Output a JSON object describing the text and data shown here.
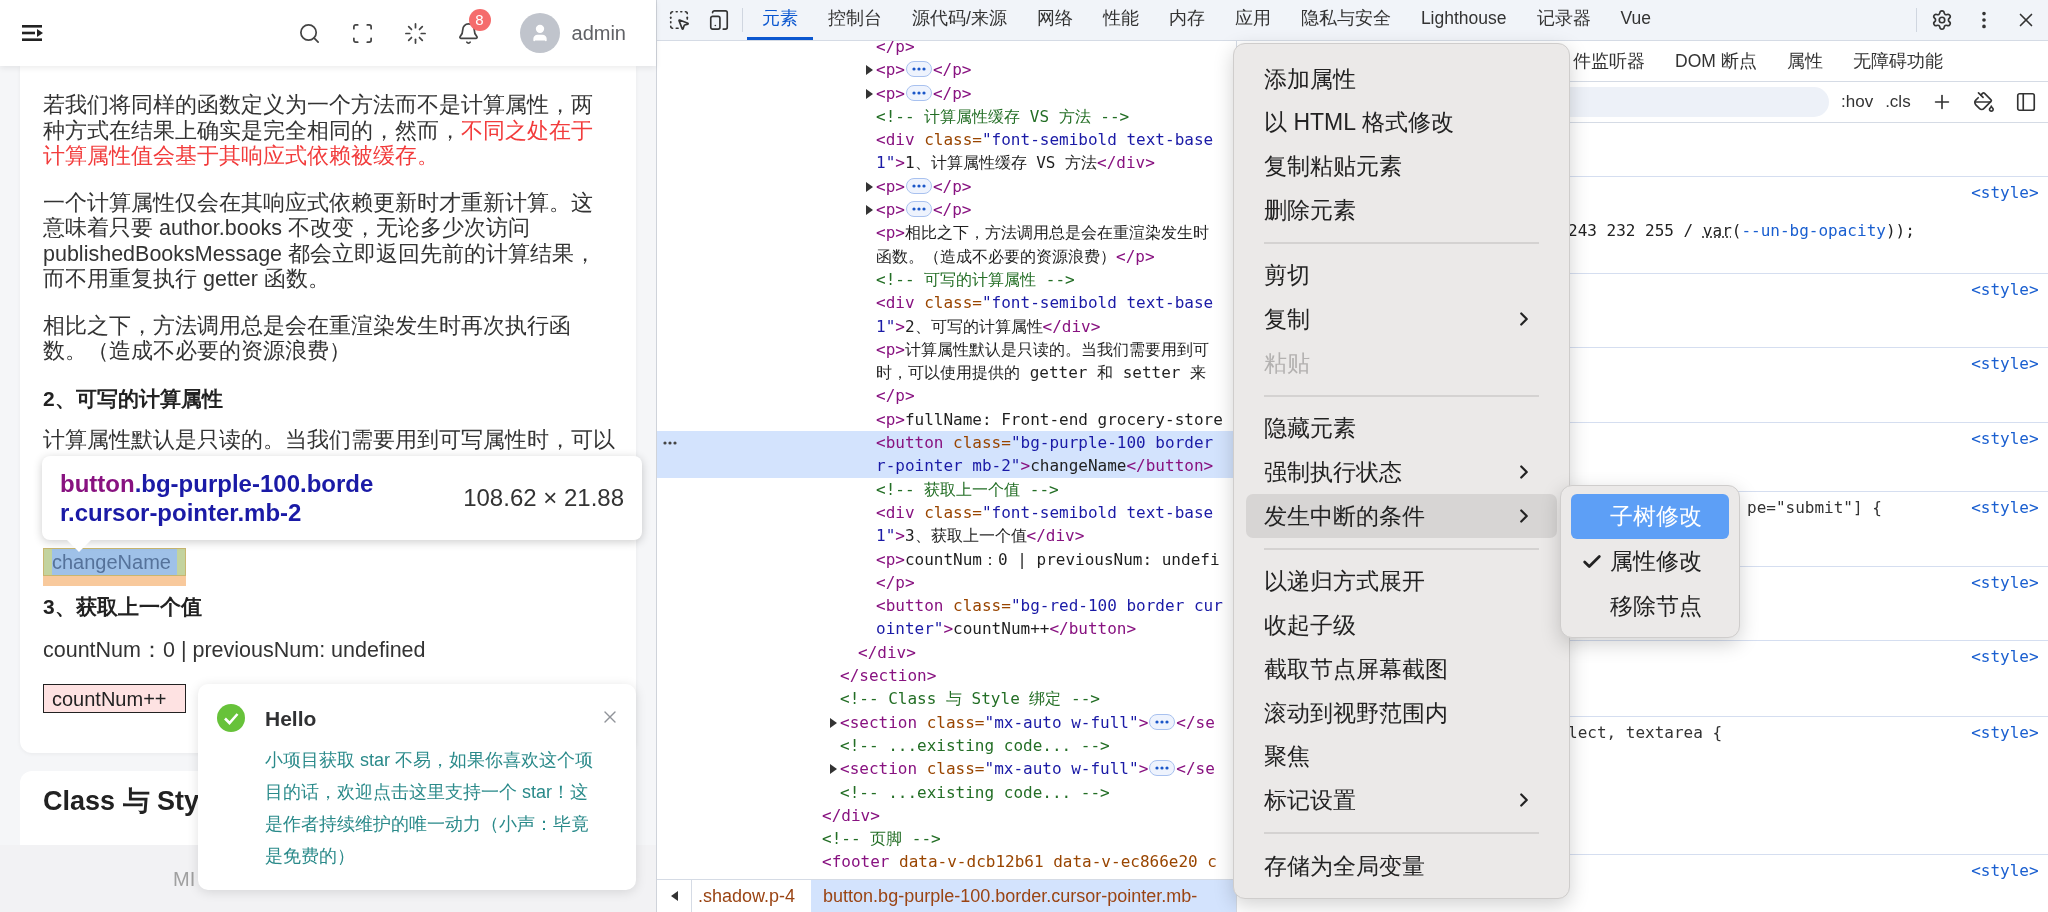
{
  "app_header": {
    "notifications": "8",
    "user": "admin"
  },
  "article": {
    "blocks": [
      {
        "kind": "paragraph",
        "segments": [
          {
            "text": "若我们将同样的函数定义为一个方法而不是计算属性，两种方式在结果上确实是完全相同的，然而，",
            "emphasis": false
          },
          {
            "text": "不同之处在于计算属性值会基于其响应式依赖被缓存。",
            "emphasis": true
          }
        ]
      },
      {
        "kind": "paragraph",
        "segments": [
          {
            "text": "一个计算属性仅会在其响应式依赖更新时才重新计算。这意味着只要 author.books 不改变，无论多少次访问 publishedBooksMessage 都会立即返回先前的计算结果，而不用重复执行 getter 函数。",
            "emphasis": false
          }
        ]
      },
      {
        "kind": "paragraph",
        "segments": [
          {
            "text": "相比之下，方法调用总是会在重渲染发生时再次执行函数。（造成不必要的资源浪费）",
            "emphasis": false
          }
        ]
      },
      {
        "kind": "heading",
        "text": "2、可写的计算属性"
      },
      {
        "kind": "covered_paragraph",
        "segments": [
          {
            "text": "计算属性默认是只读的。当我们需要用到可写属性时，可以",
            "emphasis": false
          }
        ]
      },
      {
        "kind": "button",
        "text": "changeName",
        "inspected": true
      },
      {
        "kind": "heading",
        "text": "3、获取上一个值"
      },
      {
        "kind": "paragraph",
        "segments": [
          {
            "text": "countNum：0 | previousNum: undefined",
            "emphasis": false
          }
        ]
      },
      {
        "kind": "button",
        "text": "countNum++",
        "inspected": false
      }
    ]
  },
  "next_card": {
    "title": "Class 与 Sty"
  },
  "footer": {
    "text": "MI"
  },
  "inspector_tooltip": {
    "tag": "button",
    "classes": ".bg-purple-100.border.cursor-pointer.mb-2",
    "size": "108.62 × 21.88"
  },
  "notification": {
    "title": "Hello",
    "message": "小项目获取 star 不易，如果你喜欢这个项目的话，欢迎点击这里支持一个 star！这是作者持续维护的唯一动力（小声：毕竟是免费的）"
  },
  "devtools": {
    "tabs": [
      {
        "label": "元素",
        "selected": true
      },
      {
        "label": "控制台",
        "selected": false
      },
      {
        "label": "源代码/来源",
        "selected": false
      },
      {
        "label": "网络",
        "selected": false
      },
      {
        "label": "性能",
        "selected": false
      },
      {
        "label": "内存",
        "selected": false
      },
      {
        "label": "应用",
        "selected": false
      },
      {
        "label": "隐私与安全",
        "selected": false
      },
      {
        "label": "Lighthouse",
        "selected": false
      },
      {
        "label": "记录器",
        "selected": false
      },
      {
        "label": "Vue",
        "selected": false
      }
    ]
  },
  "tree": [
    {
      "selected": false,
      "collapsed": false,
      "children": [
        {
          "selected": false,
          "collapsed": false,
          "children": [
            {
              "selected": false,
              "collapsed": false,
              "children": [
                {
                  "selected": false,
                  "collapsed": false,
                  "lines": [
                    [
                      {
                        "kind": "tag",
                        "text": "</p>"
                      }
                    ]
                  ]
                },
                {
                  "selected": false,
                  "collapsed": true,
                  "lines": [
                    [
                      {
                        "kind": "tag",
                        "text": "<p>"
                      },
                      {
                        "kind": "more"
                      },
                      {
                        "kind": "tag",
                        "text": "</p>"
                      }
                    ]
                  ]
                },
                {
                  "selected": false,
                  "collapsed": true,
                  "lines": [
                    [
                      {
                        "kind": "tag",
                        "text": "<p>"
                      },
                      {
                        "kind": "more"
                      },
                      {
                        "kind": "tag",
                        "text": "</p>"
                      }
                    ]
                  ]
                },
                {
                  "selected": false,
                  "collapsed": false,
                  "lines": [
                    [
                      {
                        "kind": "comment",
                        "text": "<!-- 计算属性缓存 VS 方法 -->"
                      }
                    ]
                  ]
                },
                {
                  "selected": false,
                  "collapsed": false,
                  "lines": [
                    [
                      {
                        "kind": "tag",
                        "text": "<div"
                      },
                      {
                        "kind": "attr",
                        "text": " class="
                      },
                      {
                        "kind": "value",
                        "text": "\"font-semibold text-base"
                      }
                    ],
                    [
                      {
                        "kind": "value",
                        "text": "1\""
                      },
                      {
                        "kind": "tag",
                        "text": ">"
                      },
                      {
                        "kind": "text",
                        "text": "1、计算属性缓存 VS 方法"
                      },
                      {
                        "kind": "tag",
                        "text": "</div>"
                      }
                    ]
                  ]
                },
                {
                  "selected": false,
                  "collapsed": true,
                  "lines": [
                    [
                      {
                        "kind": "tag",
                        "text": "<p>"
                      },
                      {
                        "kind": "more"
                      },
                      {
                        "kind": "tag",
                        "text": "</p>"
                      }
                    ]
                  ]
                },
                {
                  "selected": false,
                  "collapsed": true,
                  "lines": [
                    [
                      {
                        "kind": "tag",
                        "text": "<p>"
                      },
                      {
                        "kind": "more"
                      },
                      {
                        "kind": "tag",
                        "text": "</p>"
                      }
                    ]
                  ]
                },
                {
                  "selected": false,
                  "collapsed": false,
                  "lines": [
                    [
                      {
                        "kind": "tag",
                        "text": "<p>"
                      },
                      {
                        "kind": "text",
                        "text": "相比之下，方法调用总是会在重渲染发生时"
                      }
                    ],
                    [
                      {
                        "kind": "text",
                        "text": "函数。（造成不必要的资源浪费）"
                      },
                      {
                        "kind": "tag",
                        "text": "</p>"
                      }
                    ]
                  ]
                },
                {
                  "selected": false,
                  "collapsed": false,
                  "lines": [
                    [
                      {
                        "kind": "comment",
                        "text": "<!-- 可写的计算属性 -->"
                      }
                    ]
                  ]
                },
                {
                  "selected": false,
                  "collapsed": false,
                  "lines": [
                    [
                      {
                        "kind": "tag",
                        "text": "<div"
                      },
                      {
                        "kind": "attr",
                        "text": " class="
                      },
                      {
                        "kind": "value",
                        "text": "\"font-semibold text-base"
                      }
                    ],
                    [
                      {
                        "kind": "value",
                        "text": "1\""
                      },
                      {
                        "kind": "tag",
                        "text": ">"
                      },
                      {
                        "kind": "text",
                        "text": "2、可写的计算属性"
                      },
                      {
                        "kind": "tag",
                        "text": "</div>"
                      }
                    ]
                  ]
                },
                {
                  "selected": false,
                  "collapsed": false,
                  "lines": [
                    [
                      {
                        "kind": "tag",
                        "text": "<p>"
                      },
                      {
                        "kind": "text",
                        "text": "计算属性默认是只读的。当我们需要用到可"
                      }
                    ],
                    [
                      {
                        "kind": "text",
                        "text": "时，可以使用提供的 getter 和 setter 来"
                      }
                    ],
                    [
                      {
                        "kind": "tag",
                        "text": "</p>"
                      }
                    ]
                  ]
                },
                {
                  "selected": false,
                  "collapsed": false,
                  "lines": [
                    [
                      {
                        "kind": "tag",
                        "text": "<p>"
                      },
                      {
                        "kind": "text",
                        "text": "fullName: Front-end grocery-store"
                      }
                    ]
                  ]
                },
                {
                  "selected": true,
                  "collapsed": false,
                  "lines": [
                    [
                      {
                        "kind": "tag",
                        "text": "<button"
                      },
                      {
                        "kind": "attr",
                        "text": " class="
                      },
                      {
                        "kind": "value",
                        "text": "\"bg-purple-100 border"
                      }
                    ],
                    [
                      {
                        "kind": "value",
                        "text": "r-pointer mb-2\""
                      },
                      {
                        "kind": "tag",
                        "text": ">"
                      },
                      {
                        "kind": "text",
                        "text": "changeName"
                      },
                      {
                        "kind": "tag",
                        "text": "</button>"
                      }
                    ]
                  ]
                },
                {
                  "selected": false,
                  "collapsed": false,
                  "lines": [
                    [
                      {
                        "kind": "comment",
                        "text": "<!-- 获取上一个值 -->"
                      }
                    ]
                  ]
                },
                {
                  "selected": false,
                  "collapsed": false,
                  "lines": [
                    [
                      {
                        "kind": "tag",
                        "text": "<div"
                      },
                      {
                        "kind": "attr",
                        "text": " class="
                      },
                      {
                        "kind": "value",
                        "text": "\"font-semibold text-base"
                      }
                    ],
                    [
                      {
                        "kind": "value",
                        "text": "1\""
                      },
                      {
                        "kind": "tag",
                        "text": ">"
                      },
                      {
                        "kind": "text",
                        "text": "3、获取上一个值"
                      },
                      {
                        "kind": "tag",
                        "text": "</div>"
                      }
                    ]
                  ]
                },
                {
                  "selected": false,
                  "collapsed": false,
                  "lines": [
                    [
                      {
                        "kind": "tag",
                        "text": "<p>"
                      },
                      {
                        "kind": "text",
                        "text": "countNum：0 | previousNum: undefi"
                      }
                    ],
                    [
                      {
                        "kind": "tag",
                        "text": "</p>"
                      }
                    ]
                  ]
                },
                {
                  "selected": false,
                  "collapsed": false,
                  "lines": [
                    [
                      {
                        "kind": "tag",
                        "text": "<button"
                      },
                      {
                        "kind": "attr",
                        "text": " class="
                      },
                      {
                        "kind": "value",
                        "text": "\"bg-red-100 border cur"
                      }
                    ],
                    [
                      {
                        "kind": "value",
                        "text": "ointer\""
                      },
                      {
                        "kind": "tag",
                        "text": ">"
                      },
                      {
                        "kind": "text",
                        "text": "countNum++"
                      },
                      {
                        "kind": "tag",
                        "text": "</button>"
                      }
                    ]
                  ]
                }
              ],
              "close": [
                {
                  "kind": "tag",
                  "text": "</div>"
                }
              ]
            }
          ],
          "close": [
            {
              "kind": "tag",
              "text": "</section>"
            }
          ]
        },
        {
          "selected": false,
          "collapsed": false,
          "lines": [
            [
              {
                "kind": "comment",
                "text": "<!-- Class 与 Style 绑定 -->"
              }
            ]
          ]
        },
        {
          "selected": false,
          "collapsed": true,
          "lines": [
            [
              {
                "kind": "tag",
                "text": "<section"
              },
              {
                "kind": "attr",
                "text": " class="
              },
              {
                "kind": "value",
                "text": "\"mx-auto w-full\""
              },
              {
                "kind": "tag",
                "text": ">"
              },
              {
                "kind": "more"
              },
              {
                "kind": "tag",
                "text": "</se"
              }
            ]
          ]
        },
        {
          "selected": false,
          "collapsed": false,
          "lines": [
            [
              {
                "kind": "comment",
                "text": "<!-- ...existing code... -->"
              }
            ]
          ]
        },
        {
          "selected": false,
          "collapsed": true,
          "lines": [
            [
              {
                "kind": "tag",
                "text": "<section"
              },
              {
                "kind": "attr",
                "text": " class="
              },
              {
                "kind": "value",
                "text": "\"mx-auto w-full\""
              },
              {
                "kind": "tag",
                "text": ">"
              },
              {
                "kind": "more"
              },
              {
                "kind": "tag",
                "text": "</se"
              }
            ]
          ]
        },
        {
          "selected": false,
          "collapsed": false,
          "lines": [
            [
              {
                "kind": "comment",
                "text": "<!-- ...existing code... -->"
              }
            ]
          ]
        }
      ],
      "close": [
        {
          "kind": "tag",
          "text": "</div>"
        }
      ]
    },
    {
      "selected": false,
      "collapsed": false,
      "lines": [
        [
          {
            "kind": "comment",
            "text": "<!-- 页脚 -->"
          }
        ]
      ]
    },
    {
      "selected": false,
      "collapsed": false,
      "lines": [
        [
          {
            "kind": "tag",
            "text": "<footer"
          },
          {
            "kind": "attr",
            "text": " data-v-dcb12b61 data-v-ec866e20 c"
          }
        ]
      ]
    }
  ],
  "breadcrumbs": [
    {
      "label": ".shadow.p-4",
      "selected": false
    },
    {
      "label": "button.bg-purple-100.border.cursor-pointer.mb-",
      "selected": true
    }
  ],
  "styles_pane": {
    "tabs": [
      "件监听器",
      "DOM 断点",
      "属性",
      "无障碍功能"
    ],
    "toggles": [
      ":hov",
      ".cls"
    ],
    "rules": [
      {
        "source": "<style>",
        "code": [
          {
            "kind": "plain",
            "text": "243 232 255 / "
          },
          {
            "kind": "fn",
            "text": "var"
          },
          {
            "kind": "plain",
            "text": "("
          },
          {
            "kind": "var",
            "text": "--un-bg-opacity"
          },
          {
            "kind": "plain",
            "text": "));"
          }
        ]
      },
      {
        "source": "<style>"
      },
      {
        "source": "<style>"
      },
      {
        "source": "<style>"
      },
      {
        "source": "<style>",
        "code": [
          {
            "kind": "plain",
            "text": "pe=\"submit\"] {"
          }
        ]
      },
      {
        "source": "<style>"
      },
      {
        "source": "<style>"
      },
      {
        "source": "<style>",
        "code": [
          {
            "kind": "plain",
            "text": "lect, textarea {"
          }
        ]
      },
      {
        "source": "<style>"
      }
    ]
  },
  "context_menu": {
    "items": [
      {
        "kind": "item",
        "label": "添加属性",
        "disabled": false,
        "highlighted": false
      },
      {
        "kind": "item",
        "label": "以 HTML 格式修改",
        "disabled": false,
        "highlighted": false
      },
      {
        "kind": "item",
        "label": "复制粘贴元素",
        "disabled": false,
        "highlighted": false
      },
      {
        "kind": "item",
        "label": "删除元素",
        "disabled": false,
        "highlighted": false
      },
      {
        "kind": "separator"
      },
      {
        "kind": "item",
        "label": "剪切",
        "disabled": false,
        "highlighted": false
      },
      {
        "kind": "submenu",
        "label": "复制",
        "disabled": false,
        "highlighted": false
      },
      {
        "kind": "item",
        "label": "粘贴",
        "disabled": true,
        "highlighted": false
      },
      {
        "kind": "separator"
      },
      {
        "kind": "item",
        "label": "隐藏元素",
        "disabled": false,
        "highlighted": false
      },
      {
        "kind": "submenu",
        "label": "强制执行状态",
        "disabled": false,
        "highlighted": false
      },
      {
        "kind": "submenu",
        "label": "发生中断的条件",
        "disabled": false,
        "highlighted": true
      },
      {
        "kind": "separator"
      },
      {
        "kind": "item",
        "label": "以递归方式展开",
        "disabled": false,
        "highlighted": false
      },
      {
        "kind": "item",
        "label": "收起子级",
        "disabled": false,
        "highlighted": false
      },
      {
        "kind": "item",
        "label": "截取节点屏幕截图",
        "disabled": false,
        "highlighted": false
      },
      {
        "kind": "item",
        "label": "滚动到视野范围内",
        "disabled": false,
        "highlighted": false
      },
      {
        "kind": "item",
        "label": "聚焦",
        "disabled": false,
        "highlighted": false
      },
      {
        "kind": "submenu",
        "label": "标记设置",
        "disabled": false,
        "highlighted": false
      },
      {
        "kind": "separator"
      },
      {
        "kind": "item",
        "label": "存储为全局变量",
        "disabled": false,
        "highlighted": false
      }
    ]
  },
  "submenu": {
    "items": [
      {
        "label": "子树修改",
        "checked": false,
        "highlighted": true
      },
      {
        "label": "属性修改",
        "checked": true,
        "highlighted": false
      },
      {
        "label": "移除节点",
        "checked": false,
        "highlighted": false
      }
    ]
  }
}
